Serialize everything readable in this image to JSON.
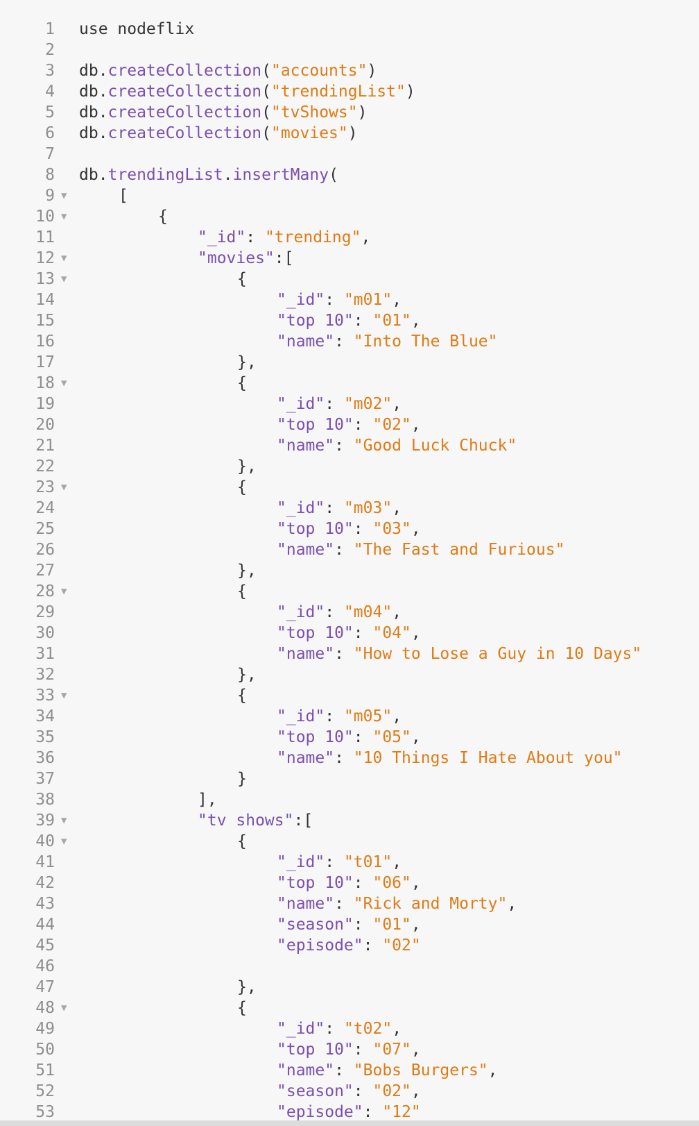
{
  "editor": {
    "fold_glyph": "▼",
    "lines": [
      {
        "n": "1",
        "fold": false,
        "indent": 0,
        "tokens": [
          [
            "p",
            "use nodeflix"
          ]
        ]
      },
      {
        "n": "2",
        "fold": false,
        "indent": 0,
        "tokens": []
      },
      {
        "n": "3",
        "fold": false,
        "indent": 0,
        "tokens": [
          [
            "p",
            "db."
          ],
          [
            "m",
            "createCollection"
          ],
          [
            "p",
            "("
          ],
          [
            "s",
            "\"accounts\""
          ],
          [
            "p",
            ")"
          ]
        ]
      },
      {
        "n": "4",
        "fold": false,
        "indent": 0,
        "tokens": [
          [
            "p",
            "db."
          ],
          [
            "m",
            "createCollection"
          ],
          [
            "p",
            "("
          ],
          [
            "s",
            "\"trendingList\""
          ],
          [
            "p",
            ")"
          ]
        ]
      },
      {
        "n": "5",
        "fold": false,
        "indent": 0,
        "tokens": [
          [
            "p",
            "db."
          ],
          [
            "m",
            "createCollection"
          ],
          [
            "p",
            "("
          ],
          [
            "s",
            "\"tvShows\""
          ],
          [
            "p",
            ")"
          ]
        ]
      },
      {
        "n": "6",
        "fold": false,
        "indent": 0,
        "tokens": [
          [
            "p",
            "db."
          ],
          [
            "m",
            "createCollection"
          ],
          [
            "p",
            "("
          ],
          [
            "s",
            "\"movies\""
          ],
          [
            "p",
            ")"
          ]
        ]
      },
      {
        "n": "7",
        "fold": false,
        "indent": 0,
        "tokens": []
      },
      {
        "n": "8",
        "fold": false,
        "indent": 0,
        "tokens": [
          [
            "p",
            "db."
          ],
          [
            "m",
            "trendingList"
          ],
          [
            "p",
            "."
          ],
          [
            "m",
            "insertMany"
          ],
          [
            "p",
            "("
          ]
        ]
      },
      {
        "n": "9",
        "fold": true,
        "indent": 1,
        "tokens": [
          [
            "p",
            "["
          ]
        ]
      },
      {
        "n": "10",
        "fold": true,
        "indent": 2,
        "tokens": [
          [
            "p",
            "{"
          ]
        ]
      },
      {
        "n": "11",
        "fold": false,
        "indent": 3,
        "tokens": [
          [
            "k",
            "\"_id\""
          ],
          [
            "p",
            ": "
          ],
          [
            "s",
            "\"trending\""
          ],
          [
            "p",
            ","
          ]
        ]
      },
      {
        "n": "12",
        "fold": true,
        "indent": 3,
        "tokens": [
          [
            "k",
            "\"movies\""
          ],
          [
            "p",
            ":["
          ]
        ]
      },
      {
        "n": "13",
        "fold": true,
        "indent": 4,
        "tokens": [
          [
            "p",
            "{"
          ]
        ]
      },
      {
        "n": "14",
        "fold": false,
        "indent": 5,
        "tokens": [
          [
            "k",
            "\"_id\""
          ],
          [
            "p",
            ": "
          ],
          [
            "s",
            "\"m01\""
          ],
          [
            "p",
            ","
          ]
        ]
      },
      {
        "n": "15",
        "fold": false,
        "indent": 5,
        "tokens": [
          [
            "k",
            "\"top 10\""
          ],
          [
            "p",
            ": "
          ],
          [
            "s",
            "\"01\""
          ],
          [
            "p",
            ","
          ]
        ]
      },
      {
        "n": "16",
        "fold": false,
        "indent": 5,
        "tokens": [
          [
            "k",
            "\"name\""
          ],
          [
            "p",
            ": "
          ],
          [
            "s",
            "\"Into The Blue\""
          ]
        ]
      },
      {
        "n": "17",
        "fold": false,
        "indent": 4,
        "tokens": [
          [
            "p",
            "},"
          ]
        ]
      },
      {
        "n": "18",
        "fold": true,
        "indent": 4,
        "tokens": [
          [
            "p",
            "{"
          ]
        ]
      },
      {
        "n": "19",
        "fold": false,
        "indent": 5,
        "tokens": [
          [
            "k",
            "\"_id\""
          ],
          [
            "p",
            ": "
          ],
          [
            "s",
            "\"m02\""
          ],
          [
            "p",
            ","
          ]
        ]
      },
      {
        "n": "20",
        "fold": false,
        "indent": 5,
        "tokens": [
          [
            "k",
            "\"top 10\""
          ],
          [
            "p",
            ": "
          ],
          [
            "s",
            "\"02\""
          ],
          [
            "p",
            ","
          ]
        ]
      },
      {
        "n": "21",
        "fold": false,
        "indent": 5,
        "tokens": [
          [
            "k",
            "\"name\""
          ],
          [
            "p",
            ": "
          ],
          [
            "s",
            "\"Good Luck Chuck\""
          ]
        ]
      },
      {
        "n": "22",
        "fold": false,
        "indent": 4,
        "tokens": [
          [
            "p",
            "},"
          ]
        ]
      },
      {
        "n": "23",
        "fold": true,
        "indent": 4,
        "tokens": [
          [
            "p",
            "{"
          ]
        ]
      },
      {
        "n": "24",
        "fold": false,
        "indent": 5,
        "tokens": [
          [
            "k",
            "\"_id\""
          ],
          [
            "p",
            ": "
          ],
          [
            "s",
            "\"m03\""
          ],
          [
            "p",
            ","
          ]
        ]
      },
      {
        "n": "25",
        "fold": false,
        "indent": 5,
        "tokens": [
          [
            "k",
            "\"top 10\""
          ],
          [
            "p",
            ": "
          ],
          [
            "s",
            "\"03\""
          ],
          [
            "p",
            ","
          ]
        ]
      },
      {
        "n": "26",
        "fold": false,
        "indent": 5,
        "tokens": [
          [
            "k",
            "\"name\""
          ],
          [
            "p",
            ": "
          ],
          [
            "s",
            "\"The Fast and Furious\""
          ]
        ]
      },
      {
        "n": "27",
        "fold": false,
        "indent": 4,
        "tokens": [
          [
            "p",
            "},"
          ]
        ]
      },
      {
        "n": "28",
        "fold": true,
        "indent": 4,
        "tokens": [
          [
            "p",
            "{"
          ]
        ]
      },
      {
        "n": "29",
        "fold": false,
        "indent": 5,
        "tokens": [
          [
            "k",
            "\"_id\""
          ],
          [
            "p",
            ": "
          ],
          [
            "s",
            "\"m04\""
          ],
          [
            "p",
            ","
          ]
        ]
      },
      {
        "n": "30",
        "fold": false,
        "indent": 5,
        "tokens": [
          [
            "k",
            "\"top 10\""
          ],
          [
            "p",
            ": "
          ],
          [
            "s",
            "\"04\""
          ],
          [
            "p",
            ","
          ]
        ]
      },
      {
        "n": "31",
        "fold": false,
        "indent": 5,
        "tokens": [
          [
            "k",
            "\"name\""
          ],
          [
            "p",
            ": "
          ],
          [
            "s",
            "\"How to Lose a Guy in 10 Days\""
          ]
        ]
      },
      {
        "n": "32",
        "fold": false,
        "indent": 4,
        "tokens": [
          [
            "p",
            "},"
          ]
        ]
      },
      {
        "n": "33",
        "fold": true,
        "indent": 4,
        "tokens": [
          [
            "p",
            "{"
          ]
        ]
      },
      {
        "n": "34",
        "fold": false,
        "indent": 5,
        "tokens": [
          [
            "k",
            "\"_id\""
          ],
          [
            "p",
            ": "
          ],
          [
            "s",
            "\"m05\""
          ],
          [
            "p",
            ","
          ]
        ]
      },
      {
        "n": "35",
        "fold": false,
        "indent": 5,
        "tokens": [
          [
            "k",
            "\"top 10\""
          ],
          [
            "p",
            ": "
          ],
          [
            "s",
            "\"05\""
          ],
          [
            "p",
            ","
          ]
        ]
      },
      {
        "n": "36",
        "fold": false,
        "indent": 5,
        "tokens": [
          [
            "k",
            "\"name\""
          ],
          [
            "p",
            ": "
          ],
          [
            "s",
            "\"10 Things I Hate About you\""
          ]
        ]
      },
      {
        "n": "37",
        "fold": false,
        "indent": 4,
        "tokens": [
          [
            "p",
            "}"
          ]
        ]
      },
      {
        "n": "38",
        "fold": false,
        "indent": 3,
        "tokens": [
          [
            "p",
            "],"
          ]
        ]
      },
      {
        "n": "39",
        "fold": true,
        "indent": 3,
        "tokens": [
          [
            "k",
            "\"tv shows\""
          ],
          [
            "p",
            ":["
          ]
        ]
      },
      {
        "n": "40",
        "fold": true,
        "indent": 4,
        "tokens": [
          [
            "p",
            "{"
          ]
        ]
      },
      {
        "n": "41",
        "fold": false,
        "indent": 5,
        "tokens": [
          [
            "k",
            "\"_id\""
          ],
          [
            "p",
            ": "
          ],
          [
            "s",
            "\"t01\""
          ],
          [
            "p",
            ","
          ]
        ]
      },
      {
        "n": "42",
        "fold": false,
        "indent": 5,
        "tokens": [
          [
            "k",
            "\"top 10\""
          ],
          [
            "p",
            ": "
          ],
          [
            "s",
            "\"06\""
          ],
          [
            "p",
            ","
          ]
        ]
      },
      {
        "n": "43",
        "fold": false,
        "indent": 5,
        "tokens": [
          [
            "k",
            "\"name\""
          ],
          [
            "p",
            ": "
          ],
          [
            "s",
            "\"Rick and Morty\""
          ],
          [
            "p",
            ","
          ]
        ]
      },
      {
        "n": "44",
        "fold": false,
        "indent": 5,
        "tokens": [
          [
            "k",
            "\"season\""
          ],
          [
            "p",
            ": "
          ],
          [
            "s",
            "\"01\""
          ],
          [
            "p",
            ","
          ]
        ]
      },
      {
        "n": "45",
        "fold": false,
        "indent": 5,
        "tokens": [
          [
            "k",
            "\"episode\""
          ],
          [
            "p",
            ": "
          ],
          [
            "s",
            "\"02\""
          ]
        ]
      },
      {
        "n": "46",
        "fold": false,
        "indent": 0,
        "tokens": []
      },
      {
        "n": "47",
        "fold": false,
        "indent": 4,
        "tokens": [
          [
            "p",
            "},"
          ]
        ]
      },
      {
        "n": "48",
        "fold": true,
        "indent": 4,
        "tokens": [
          [
            "p",
            "{"
          ]
        ]
      },
      {
        "n": "49",
        "fold": false,
        "indent": 5,
        "tokens": [
          [
            "k",
            "\"_id\""
          ],
          [
            "p",
            ": "
          ],
          [
            "s",
            "\"t02\""
          ],
          [
            "p",
            ","
          ]
        ]
      },
      {
        "n": "50",
        "fold": false,
        "indent": 5,
        "tokens": [
          [
            "k",
            "\"top 10\""
          ],
          [
            "p",
            ": "
          ],
          [
            "s",
            "\"07\""
          ],
          [
            "p",
            ","
          ]
        ]
      },
      {
        "n": "51",
        "fold": false,
        "indent": 5,
        "tokens": [
          [
            "k",
            "\"name\""
          ],
          [
            "p",
            ": "
          ],
          [
            "s",
            "\"Bobs Burgers\""
          ],
          [
            "p",
            ","
          ]
        ]
      },
      {
        "n": "52",
        "fold": false,
        "indent": 5,
        "tokens": [
          [
            "k",
            "\"season\""
          ],
          [
            "p",
            ": "
          ],
          [
            "s",
            "\"02\""
          ],
          [
            "p",
            ","
          ]
        ]
      },
      {
        "n": "53",
        "fold": false,
        "indent": 5,
        "tokens": [
          [
            "k",
            "\"episode\""
          ],
          [
            "p",
            ": "
          ],
          [
            "s",
            "\"12\""
          ]
        ]
      }
    ]
  }
}
